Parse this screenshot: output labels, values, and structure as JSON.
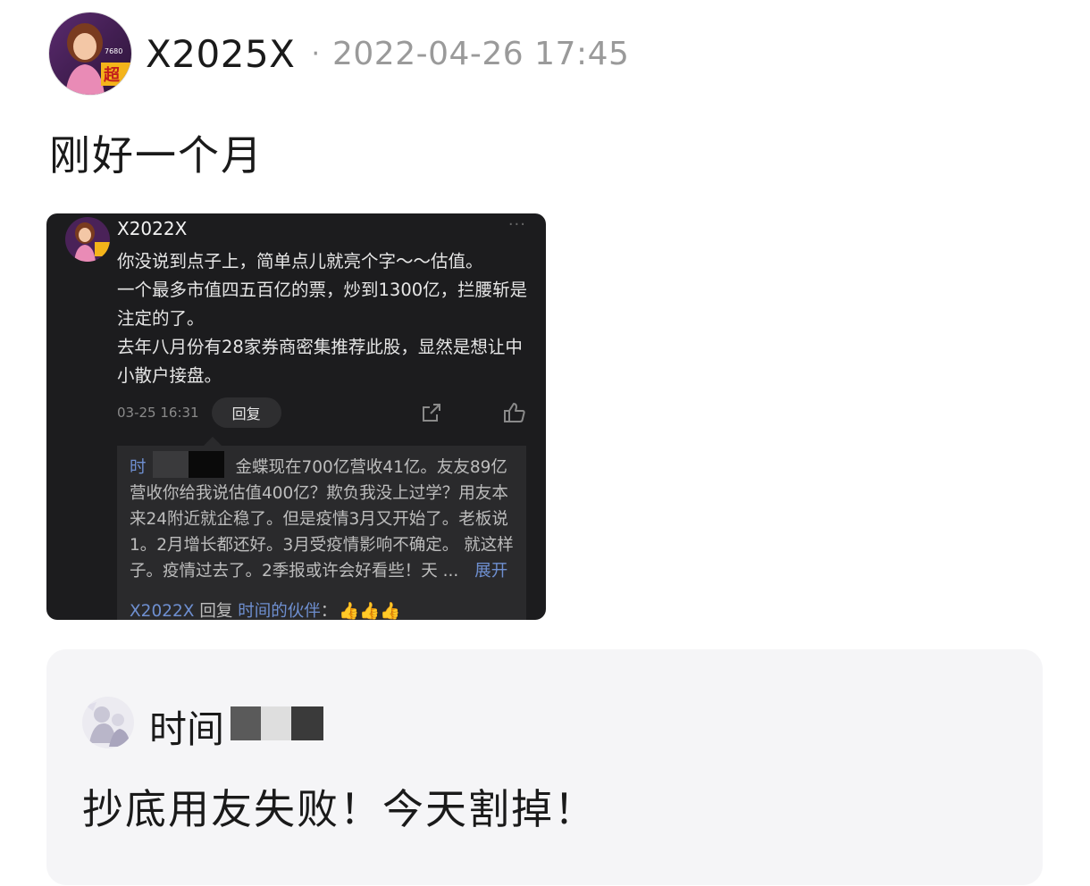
{
  "post": {
    "author": "X2025X",
    "separator": "·",
    "timestamp": "2022-04-26 17:45",
    "text": "刚好一个月",
    "avatar_icon": "game-character-avatar"
  },
  "embedded_screenshot": {
    "author": "X2022X",
    "more_label": "···",
    "paragraphs": [
      "你没说到点子上，简单点儿就亮个字～～估值。",
      "一个最多市值四五百亿的票，炒到1300亿，拦腰斩是注定的了。",
      "去年八月份有28家券商密集推荐此股，显然是想让中小散户接盘。"
    ],
    "date": "03-25 16:31",
    "reply_button": "回复",
    "quote": {
      "user_fragment": "时",
      "text": "金蝶现在700亿营收41亿。友友89亿营收你给我说估值400亿？欺负我没上过学？用友本来24附近就企稳了。但是疫情3月又开始了。老板说1。2月增长都还好。3月受疫情影响不确定。 就这样子。疫情过去了。2季报或许会好看些！天 ...",
      "expand_label": "展开"
    },
    "reply_line": {
      "user": "X2022X",
      "action": "回复",
      "target": "时间的伙伴",
      "colon": "：",
      "emoji": "👍👍👍"
    }
  },
  "quoted_comment": {
    "author_visible": "时间",
    "text": "抄底用友失败！今天割掉！",
    "avatar_icon": "anime-illustration-avatar"
  },
  "colors": {
    "background": "#ffffff",
    "text_primary": "#1a1a1a",
    "text_muted": "#9a9a9a",
    "dark_panel": "#1c1c1e",
    "link_blue": "#6e8fd0",
    "card_bg": "#f5f5f7"
  }
}
